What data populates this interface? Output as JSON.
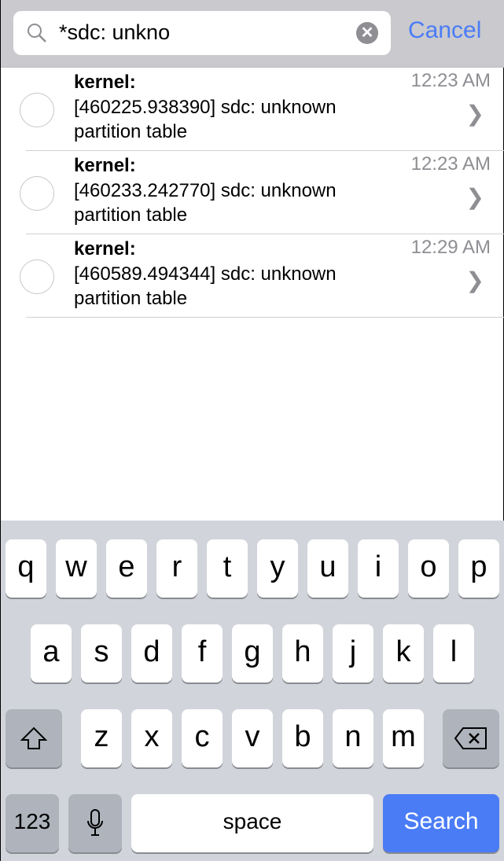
{
  "search": {
    "value": "*sdc: unkno",
    "cancel_label": "Cancel"
  },
  "rows": [
    {
      "source": "kernel:",
      "message": "[460225.938390]  sdc: unknown partition table",
      "time": "12:23 AM"
    },
    {
      "source": "kernel:",
      "message": "[460233.242770]  sdc: unknown partition table",
      "time": "12:23 AM"
    },
    {
      "source": "kernel:",
      "message": "[460589.494344]  sdc: unknown partition table",
      "time": "12:29 AM"
    }
  ],
  "keyboard": {
    "row1": [
      "q",
      "w",
      "e",
      "r",
      "t",
      "y",
      "u",
      "i",
      "o",
      "p"
    ],
    "row2": [
      "a",
      "s",
      "d",
      "f",
      "g",
      "h",
      "j",
      "k",
      "l"
    ],
    "row3": [
      "z",
      "x",
      "c",
      "v",
      "b",
      "n",
      "m"
    ],
    "numbers_label": "123",
    "space_label": "space",
    "search_label": "Search"
  },
  "colors": {
    "accent": "#4a7cf6",
    "keyboard_bg": "#d1d4da"
  }
}
